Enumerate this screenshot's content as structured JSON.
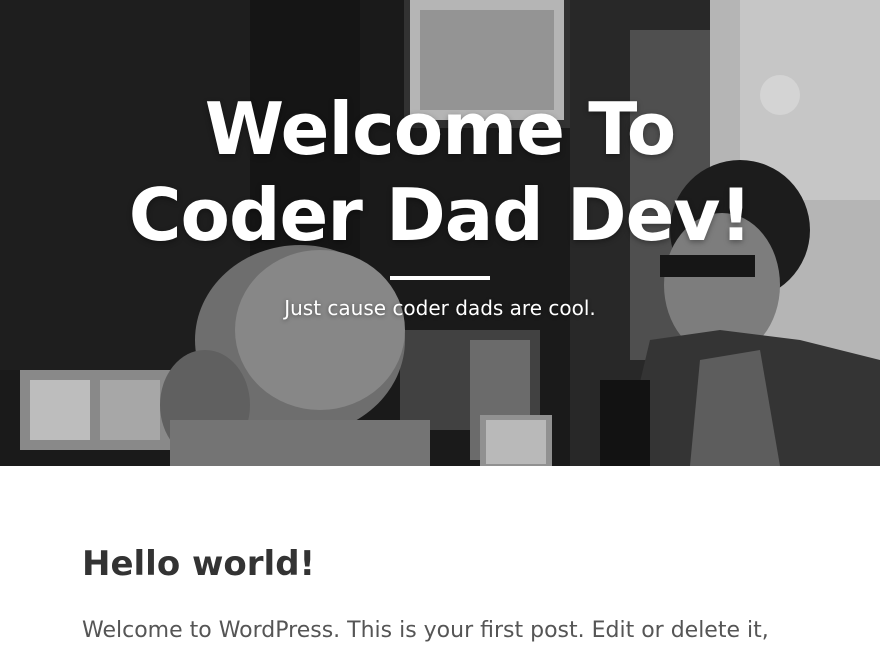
{
  "hero": {
    "title_line1": "Welcome To",
    "title_line2": "Coder Dad Dev!",
    "tagline": "Just cause coder dads are cool.",
    "background_description_icon": "cafe-photo-background"
  },
  "post": {
    "title": "Hello world!",
    "excerpt": "Welcome to WordPress. This is your first post. Edit or delete it,"
  },
  "colors": {
    "title_text": "#ffffff",
    "post_title": "#333333",
    "post_body": "#555555",
    "page_bg": "#ffffff"
  }
}
